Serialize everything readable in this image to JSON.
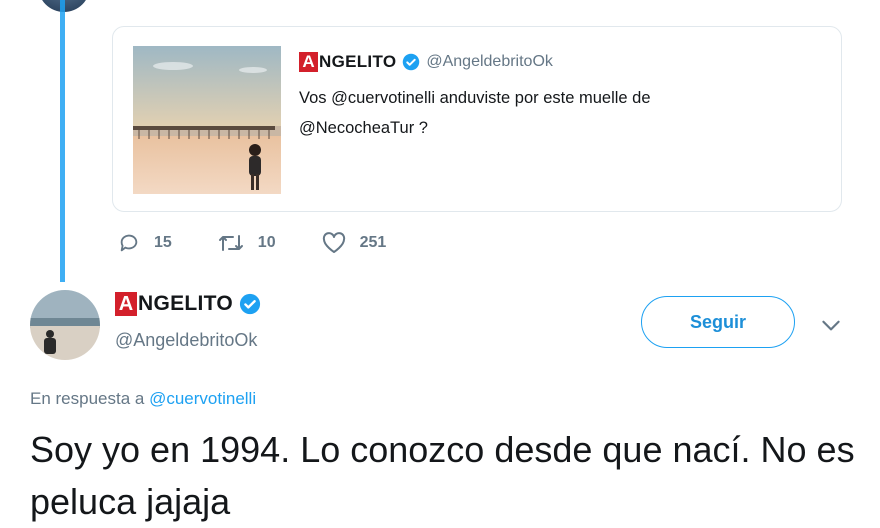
{
  "quoted_tweet": {
    "name_badge_letter": "A",
    "name_rest": "NGELITO",
    "handle": "@AngeldebritoOk",
    "text_line1": "Vos @cuervotinelli anduviste por este muelle de",
    "text_line2": "@NecocheaTur ?"
  },
  "actions": {
    "replies": "15",
    "retweets": "10",
    "likes": "251"
  },
  "author": {
    "name_badge_letter": "A",
    "name_rest": "NGELITO",
    "handle": "@AngeldebritoOk",
    "follow_label": "Seguir"
  },
  "reply_to": {
    "prefix": "En respuesta a",
    "mention": "@cuervotinelli"
  },
  "tweet_text": "Soy yo en 1994. Lo conozco desde que nací. No es peluca jajaja",
  "colors": {
    "accent": "#1da1f2",
    "badge_red": "#d3202b",
    "muted": "#657786"
  }
}
